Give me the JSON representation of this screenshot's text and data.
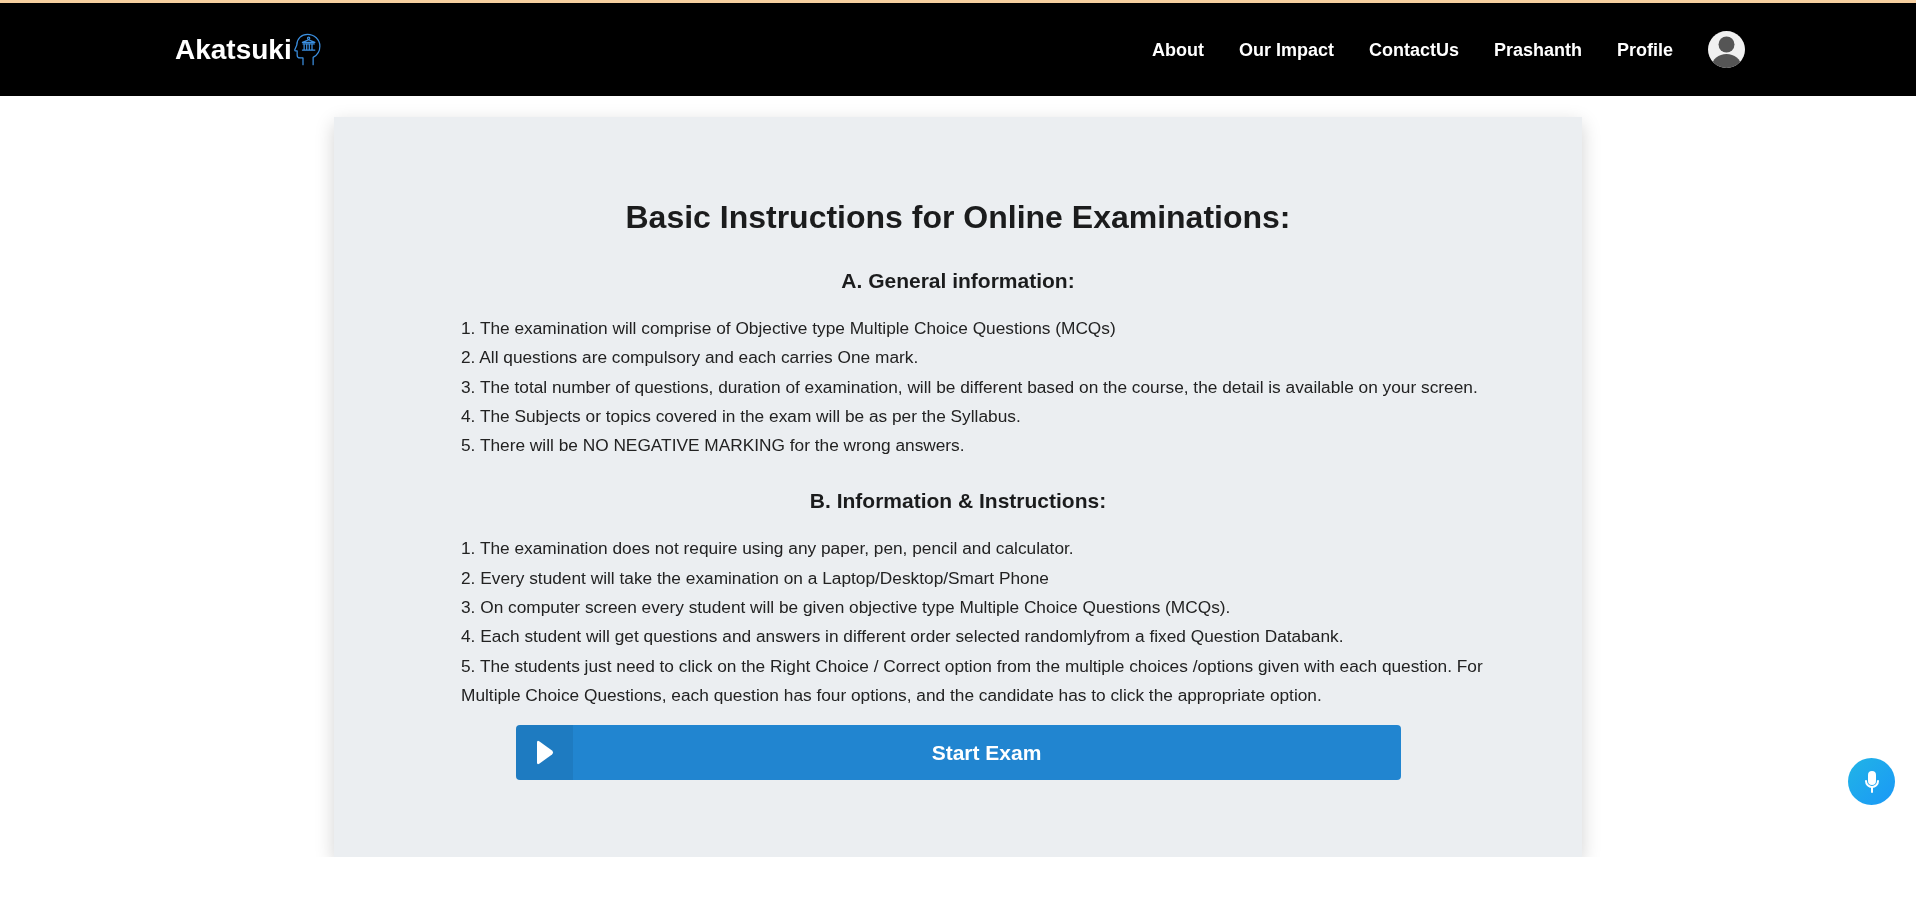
{
  "navbar": {
    "brand": "Akatsuki",
    "links": [
      "About",
      "Our Impact",
      "ContactUs",
      "Prashanth",
      "Profile"
    ]
  },
  "card": {
    "title": "Basic Instructions for Online Examinations:",
    "sections": [
      {
        "heading": "A. General information:",
        "items": [
          "1. The examination will comprise of Objective type Multiple Choice Questions (MCQs)",
          "2. All questions are compulsory and each carries One mark.",
          "3. The total number of questions, duration of examination, will be different based on the course, the detail is available on your screen.",
          "4. The Subjects or topics covered in the exam will be as per the Syllabus.",
          "5. There will be NO NEGATIVE MARKING for the wrong answers."
        ]
      },
      {
        "heading": "B. Information & Instructions:",
        "items": [
          "1. The examination does not require using any paper, pen, pencil and calculator.",
          "2. Every student will take the examination on a Laptop/Desktop/Smart Phone",
          "3. On computer screen every student will be given objective type Multiple Choice Questions (MCQs).",
          "4. Each student will get questions and answers in different order selected randomlyfrom a fixed Question Databank.",
          "5. The students just need to click on the Right Choice / Correct option from the multiple choices /options given with each question. For Multiple Choice Questions, each question has four options, and the candidate has to click the appropriate option."
        ]
      }
    ],
    "button": {
      "label": "Start Exam"
    }
  }
}
